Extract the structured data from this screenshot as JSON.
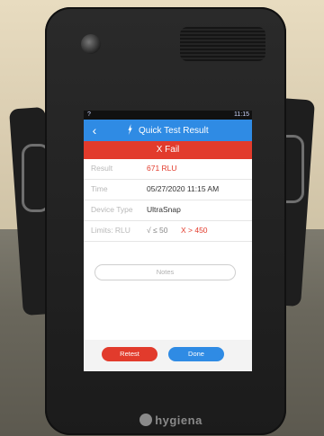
{
  "status_bar": {
    "left": "?",
    "right": "11:15"
  },
  "header": {
    "back_icon": "back-arrow-icon",
    "title": "Quick Test Result",
    "title_icon": "flask-icon"
  },
  "result_banner": {
    "icon": "x-icon",
    "text": "X Fail"
  },
  "fields": [
    {
      "label": "Result",
      "value": "671 RLU"
    },
    {
      "label": "Time",
      "value": "05/27/2020 11:15 AM"
    },
    {
      "label": "Device Type",
      "value": "UltraSnap"
    }
  ],
  "limits": {
    "label": "Limits: RLU",
    "pass_text": "√ ≤ 50",
    "fail_text": "X > 450"
  },
  "notes_label": "Notes",
  "buttons": {
    "retest": "Retest",
    "done": "Done"
  },
  "brand": "hygiena",
  "colors": {
    "accent_blue": "#2f8be4",
    "fail_red": "#e23b2c"
  }
}
